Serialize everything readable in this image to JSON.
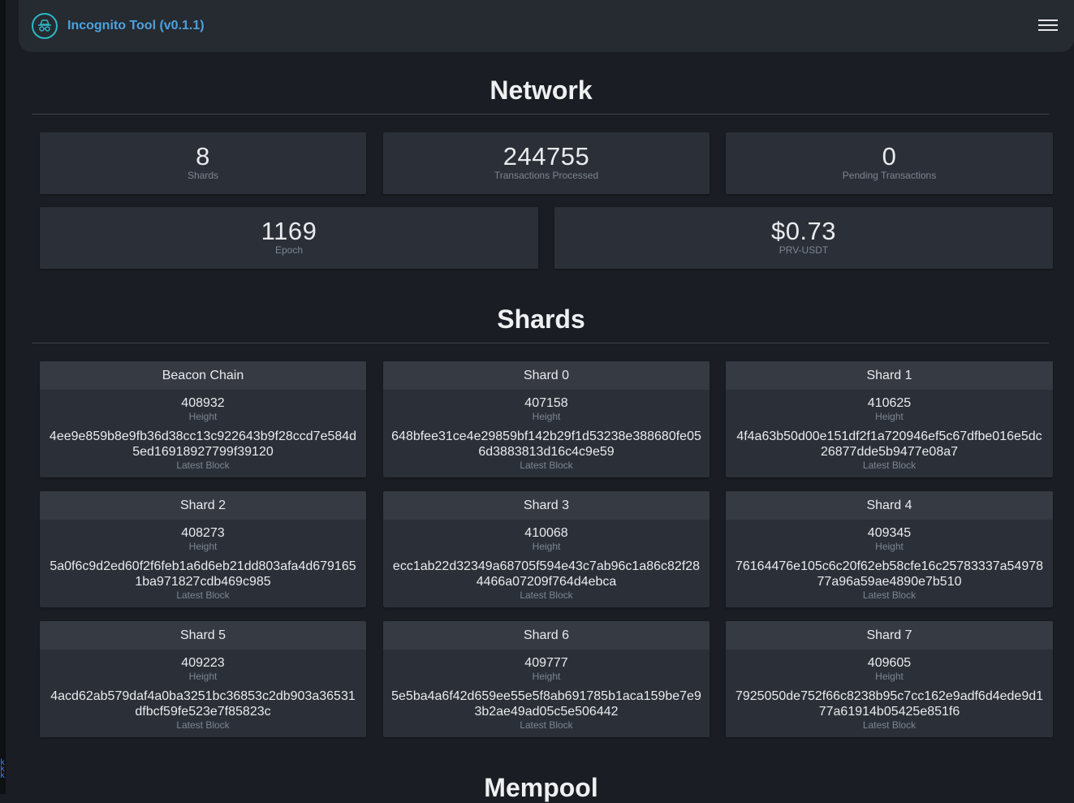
{
  "app": {
    "title": "Incognito Tool (v0.1.1)"
  },
  "sidebar_marks": "k k k",
  "network": {
    "title": "Network",
    "stats_row1": [
      {
        "value": "8",
        "label": "Shards"
      },
      {
        "value": "244755",
        "label": "Transactions Processed"
      },
      {
        "value": "0",
        "label": "Pending Transactions"
      }
    ],
    "stats_row2": [
      {
        "value": "1169",
        "label": "Epoch"
      },
      {
        "value": "$0.73",
        "label": "PRV-USDT"
      }
    ]
  },
  "shards": {
    "title": "Shards",
    "height_label": "Height",
    "block_label": "Latest Block",
    "items": [
      {
        "name": "Beacon Chain",
        "height": "408932",
        "block": "4ee9e859b8e9fb36d38cc13c922643b9f28ccd7e584d5ed16918927799f39120"
      },
      {
        "name": "Shard 0",
        "height": "407158",
        "block": "648bfee31ce4e29859bf142b29f1d53238e388680fe056d3883813d16c4c9e59"
      },
      {
        "name": "Shard 1",
        "height": "410625",
        "block": "4f4a63b50d00e151df2f1a720946ef5c67dfbe016e5dc26877dde5b9477e08a7"
      },
      {
        "name": "Shard 2",
        "height": "408273",
        "block": "5a0f6c9d2ed60f2f6feb1a6d6eb21dd803afa4d6791651ba971827cdb469c985"
      },
      {
        "name": "Shard 3",
        "height": "410068",
        "block": "ecc1ab22d32349a68705f594e43c7ab96c1a86c82f284466a07209f764d4ebca"
      },
      {
        "name": "Shard 4",
        "height": "409345",
        "block": "76164476e105c6c20f62eb58cfe16c25783337a5497877a96a59ae4890e7b510"
      },
      {
        "name": "Shard 5",
        "height": "409223",
        "block": "4acd62ab579daf4a0ba3251bc36853c2db903a36531dfbcf59fe523e7f85823c"
      },
      {
        "name": "Shard 6",
        "height": "409777",
        "block": "5e5ba4a6f42d659ee55e5f8ab691785b1aca159be7e93b2ae49ad05c5e506442"
      },
      {
        "name": "Shard 7",
        "height": "409605",
        "block": "7925050de752f66c8238b95c7cc162e9adf6d4ede9d177a61914b05425e851f6"
      }
    ]
  },
  "mempool": {
    "title": "Mempool"
  },
  "icons": {
    "logo": "incognito-spy-icon",
    "menu": "hamburger-menu-icon"
  }
}
